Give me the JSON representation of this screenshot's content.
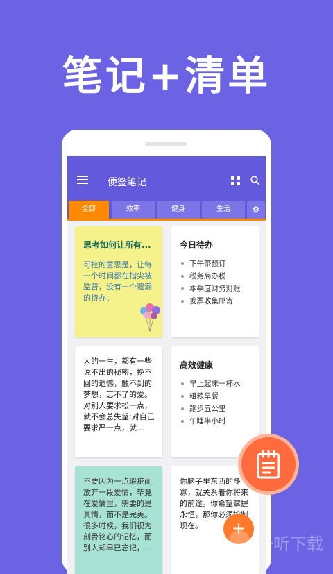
{
  "headline": "笔记+清单",
  "appbar": {
    "title": "便签笔记"
  },
  "tabs": [
    {
      "label": "全部",
      "active": true
    },
    {
      "label": "效率",
      "active": false
    },
    {
      "label": "健身",
      "active": false
    },
    {
      "label": "生活",
      "active": false
    }
  ],
  "colors": {
    "background": "#6b63e3",
    "appbar": "#6259dc",
    "tab_active": "#ff8a00",
    "note_yellow": "#f6f28b",
    "note_teal": "#a8e2d5",
    "fab": "#ff6b3d"
  },
  "notes": [
    {
      "title": "思考如何让所有...",
      "body": "可控的意思是，让每一个时间都在指尖被监督，没有一个遗漏的待办；"
    },
    {
      "title": "今日待办",
      "items": [
        "下午茶预订",
        "税务局办税",
        "本季度财务对账",
        "发票收集邮寄"
      ]
    },
    {
      "body": "人的一生，都有一些说不出的秘密，挽不回的遗憾，触不到的梦想，忘不了的爱。对别人要求松一点，就不会总失望;对自己要求严一点，就..."
    },
    {
      "title": "高效健康",
      "items": [
        "早上起床一杯水",
        "粗粮早餐",
        "跑步五公里",
        "午睡半小时"
      ]
    },
    {
      "body": "不要因为一点瑕疵而放弃一段爱情，毕竟在爱情里，需要的是真情，而不是完美。很多时候，我们视为刻骨铭心的记忆，而别人却早已忘记，..."
    },
    {
      "body": "你脑子里东西的多寡，就关系着你将来的前途。你希望掌握永恒，那你必须控制现在。"
    }
  ],
  "fab_small": {
    "label": "+"
  },
  "watermark": {
    "text": "一听下载"
  }
}
